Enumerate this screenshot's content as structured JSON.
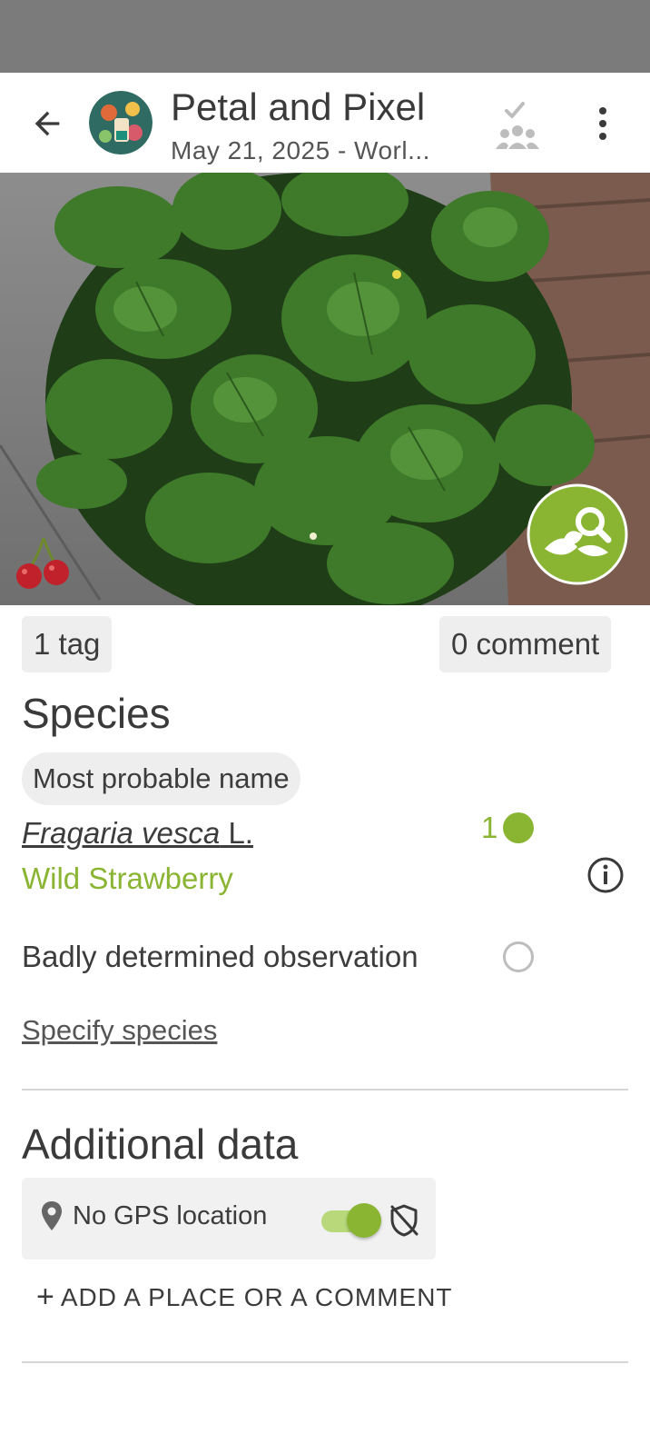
{
  "header": {
    "title": "Petal and Pixel",
    "subtitle": "May 21, 2025 - Worl...",
    "back_icon": "arrow-left-icon",
    "validate_icon": "group-check-icon",
    "more_icon": "more-vertical-icon"
  },
  "photo": {
    "identify_icon": "leaf-search-icon",
    "cherry_icon": "cherry-icon"
  },
  "chips": {
    "tags": "1 tag",
    "comments": "0 comment"
  },
  "species": {
    "heading": "Species",
    "most_probable_label": "Most probable name",
    "scientific_genus_species": "Fragaria vesca",
    "scientific_author": "L.",
    "common_name": "Wild Strawberry",
    "votes": "1",
    "badly_determined_label": "Badly determined observation",
    "badly_determined_checked": false,
    "specify_link": "Specify species"
  },
  "additional": {
    "heading": "Additional data",
    "gps_label": "No GPS location",
    "gps_toggle_on": true,
    "add_place_label": "ADD A PLACE OR A COMMENT"
  },
  "colors": {
    "accent": "#8ab533",
    "accent_light": "#b8d87a",
    "status_bar": "#7b7b7b",
    "chip_bg": "#eeeeee"
  }
}
